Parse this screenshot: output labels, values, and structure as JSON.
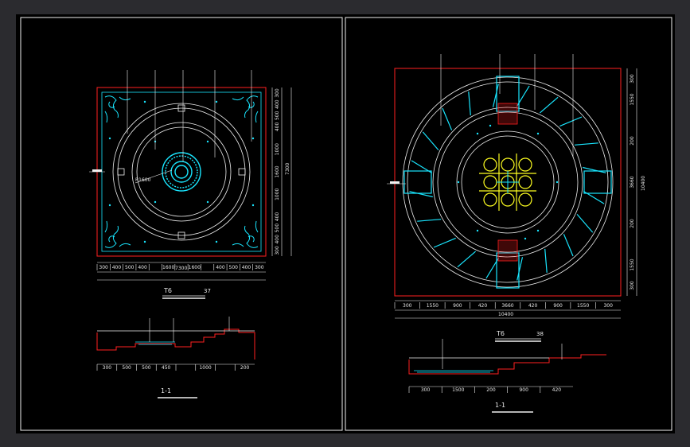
{
  "left_panel": {
    "plan_title": "T6",
    "plan_title_suffix": "37",
    "callouts_top": [
      "",
      "",
      "",
      "",
      ""
    ],
    "dims_bottom": [
      "300",
      "400",
      "500",
      "400",
      "",
      "1600",
      "",
      "1600",
      "",
      "400",
      "500",
      "400",
      "300"
    ],
    "dims_bottom_total": "7300",
    "dims_bottom_total2": "",
    "dims_right": [
      "300",
      "400",
      "500",
      "400",
      "",
      "1000",
      "",
      "1600",
      "",
      "1000",
      "",
      "400",
      "500",
      "400",
      "300"
    ],
    "dims_right_total": "7300",
    "dims_right_total2": "",
    "inner_label": "R1600",
    "section_title": "1-1",
    "section_dims": [
      "300",
      "500",
      "500",
      "450",
      "",
      "1000",
      "",
      "200"
    ]
  },
  "right_panel": {
    "plan_title": "T6",
    "plan_title_suffix": "38",
    "callouts_top": [
      "",
      "",
      "",
      ""
    ],
    "dims_bottom": [
      "300",
      "1550",
      "900",
      "420",
      "3660",
      "420",
      "900",
      "1550",
      "300"
    ],
    "dims_bottom_total": "10400",
    "dims_bottom_total2": "",
    "dims_right": [
      "300",
      "1550",
      "",
      "200",
      "",
      "3660",
      "",
      "200",
      "",
      "1550",
      "300"
    ],
    "dims_right_total": "10400",
    "section_title": "1-1",
    "section_dims": [
      "300",
      "1500",
      "200",
      "900",
      "420"
    ]
  },
  "colors": {
    "frame": "#2b2b2f",
    "background": "#000000",
    "red": "#ff2020",
    "cyan": "#19e6ff",
    "white": "#f0f0f0",
    "yellow": "#ffff20"
  }
}
